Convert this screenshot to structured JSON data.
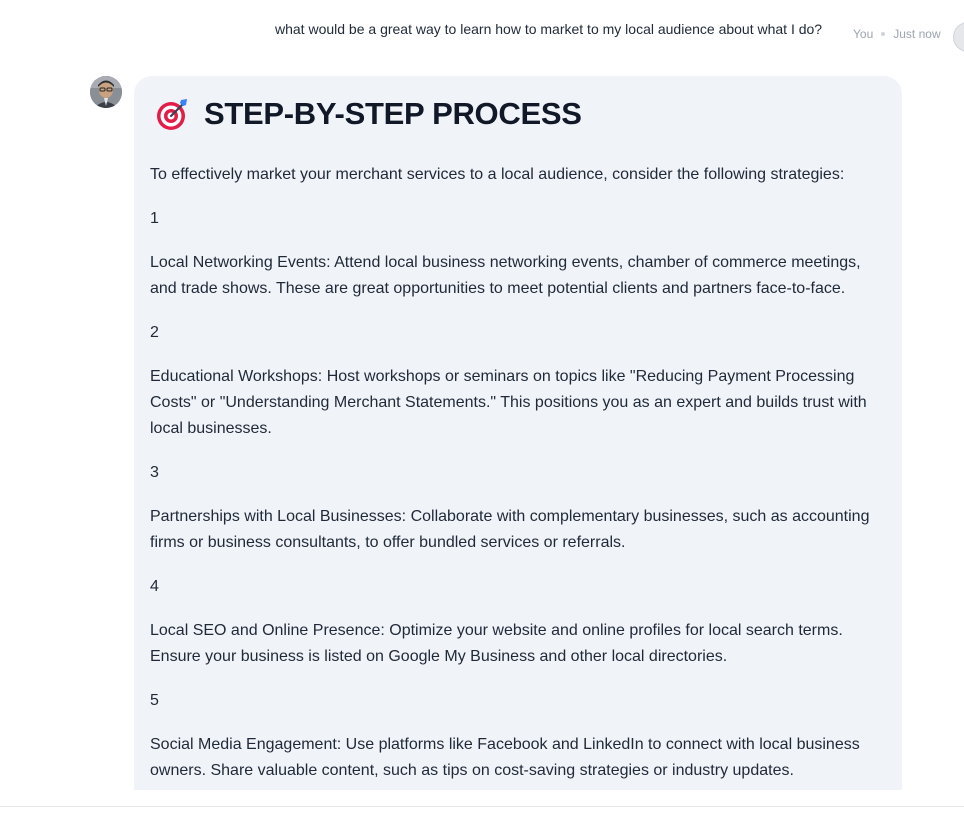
{
  "user_message": {
    "text": "what would be a great way to learn how to market to my local audience about what I do?",
    "author": "You",
    "timestamp": "Just now"
  },
  "assistant_message": {
    "heading_icon": "target-dart-icon",
    "heading": "STEP-BY-STEP PROCESS",
    "intro": "To effectively market your merchant services to a local audience, consider the following strategies:",
    "steps": [
      {
        "number": "1",
        "text": "Local Networking Events: Attend local business networking events, chamber of commerce meetings, and trade shows. These are great opportunities to meet potential clients and partners face-to-face."
      },
      {
        "number": "2",
        "text": "Educational Workshops: Host workshops or seminars on topics like \"Reducing Payment Processing Costs\" or \"Understanding Merchant Statements.\" This positions you as an expert and builds trust with local businesses."
      },
      {
        "number": "3",
        "text": "Partnerships with Local Businesses: Collaborate with complementary businesses, such as accounting firms or business consultants, to offer bundled services or referrals."
      },
      {
        "number": "4",
        "text": "Local SEO and Online Presence: Optimize your website and online profiles for local search terms. Ensure your business is listed on Google My Business and other local directories."
      },
      {
        "number": "5",
        "text": "Social Media Engagement: Use platforms like Facebook and LinkedIn to connect with local business owners. Share valuable content, such as tips on cost-saving strategies or industry updates."
      }
    ]
  },
  "colors": {
    "bubble_background": "#f0f3f8",
    "text": "#1f2937",
    "meta_text": "#9ca3af",
    "target_red": "#e11d48"
  }
}
